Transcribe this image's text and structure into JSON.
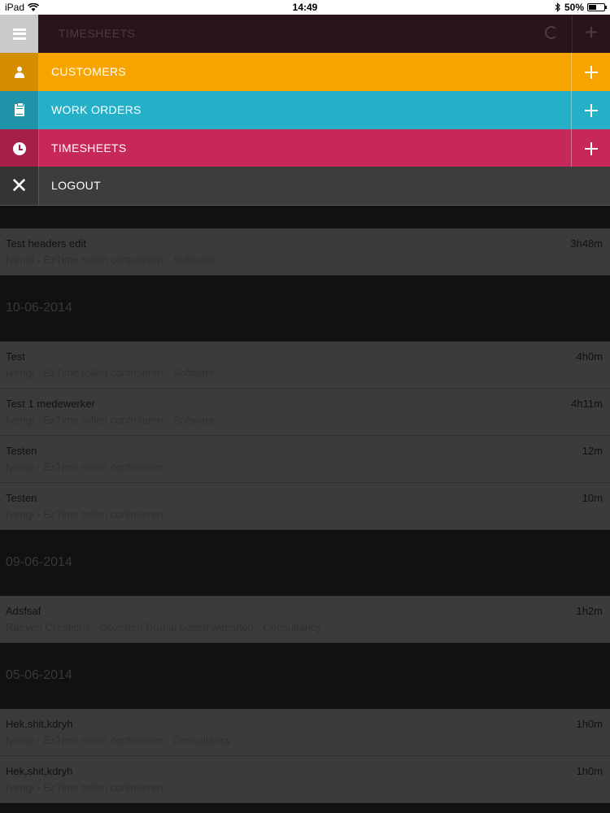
{
  "status_bar": {
    "device": "iPad",
    "time": "14:49",
    "battery": "50%",
    "battery_level": 0.5
  },
  "app_header": {
    "title": "TIMESHEETS",
    "background_color": "#2a141c"
  },
  "menu": {
    "items": [
      {
        "label": "CUSTOMERS",
        "icon": "person-icon",
        "color": "#f7a400"
      },
      {
        "label": "WORK ORDERS",
        "icon": "clipboard-icon",
        "color": "#26b0c7"
      },
      {
        "label": "TIMESHEETS",
        "icon": "clock-icon",
        "color": "#c6285a"
      },
      {
        "label": "LOGOUT",
        "icon": "close-icon",
        "color": "#3d3d3d"
      }
    ]
  },
  "timesheets": {
    "groups": [
      {
        "date": "",
        "entries": [
          {
            "name": "Test headers edit",
            "duration": "3h48m",
            "details": "Ivengi - EzTime rollen controleren - Software"
          }
        ]
      },
      {
        "date": "10-06-2014",
        "entries": [
          {
            "name": "Test",
            "duration": "4h0m",
            "details": "Ivengi - EzTime rollen controleren - Software"
          },
          {
            "name": "Test 1 medewerker",
            "duration": "4h11m",
            "details": "Ivengi - EzTime rollen controleren - Software"
          },
          {
            "name": "Testen",
            "duration": "12m",
            "details": "Ivengi - EzTime rollen controleren -"
          },
          {
            "name": "Testen",
            "duration": "10m",
            "details": "Ivengi - EzTime rollen controleren -"
          }
        ]
      },
      {
        "date": "09-06-2014",
        "entries": [
          {
            "name": "Adsfsaf",
            "duration": "1h2m",
            "details": "Raeven Creations - Opzetten Drupal based webshop - Consultancy"
          }
        ]
      },
      {
        "date": "05-06-2014",
        "entries": [
          {
            "name": "Hek,shit,kdryh",
            "duration": "1h0m",
            "details": "Ivengi - EzTime rollen controleren - Consultancy"
          },
          {
            "name": "Hek,shit,kdryh",
            "duration": "1h0m",
            "details": "Ivengi - EzTime rollen controleren -"
          }
        ]
      }
    ]
  }
}
